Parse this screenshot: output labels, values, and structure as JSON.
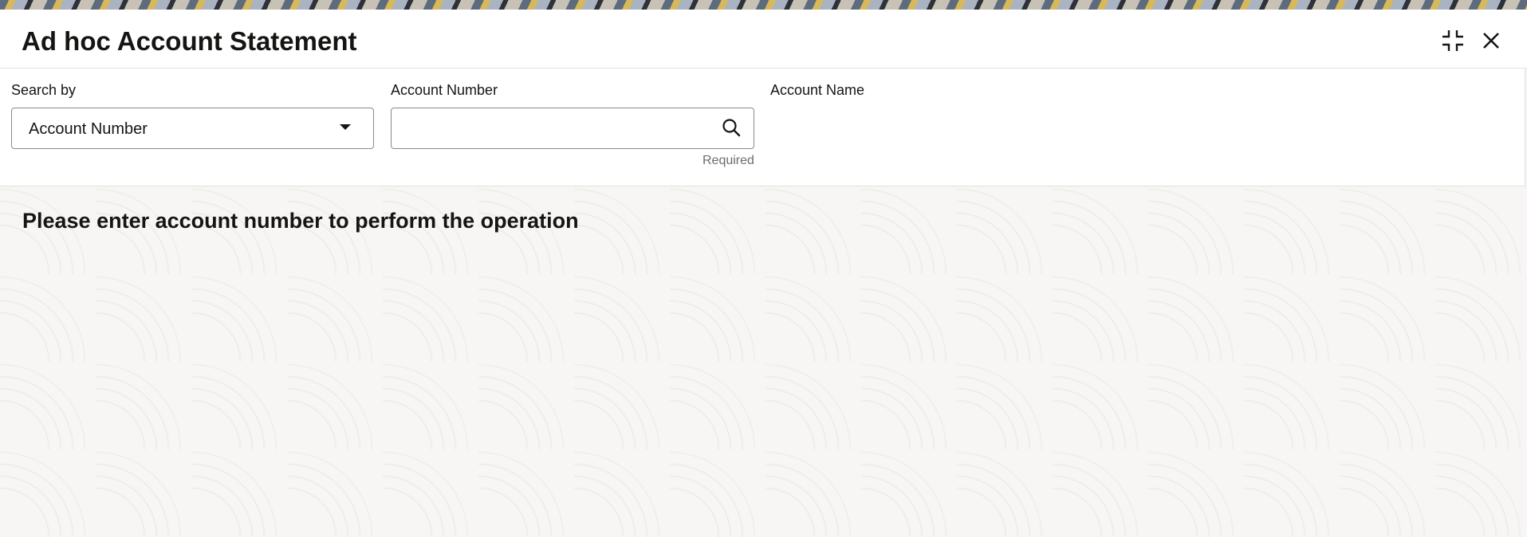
{
  "header": {
    "title": "Ad hoc Account Statement",
    "collapse_icon": "collapse-icon",
    "close_icon": "close-icon"
  },
  "form": {
    "search_by": {
      "label": "Search by",
      "selected": "Account Number"
    },
    "account_number": {
      "label": "Account Number",
      "value": "",
      "placeholder": "",
      "helper": "Required",
      "search_icon": "search-icon"
    },
    "account_name": {
      "label": "Account Name"
    }
  },
  "main": {
    "message": "Please enter account number to perform the operation"
  }
}
